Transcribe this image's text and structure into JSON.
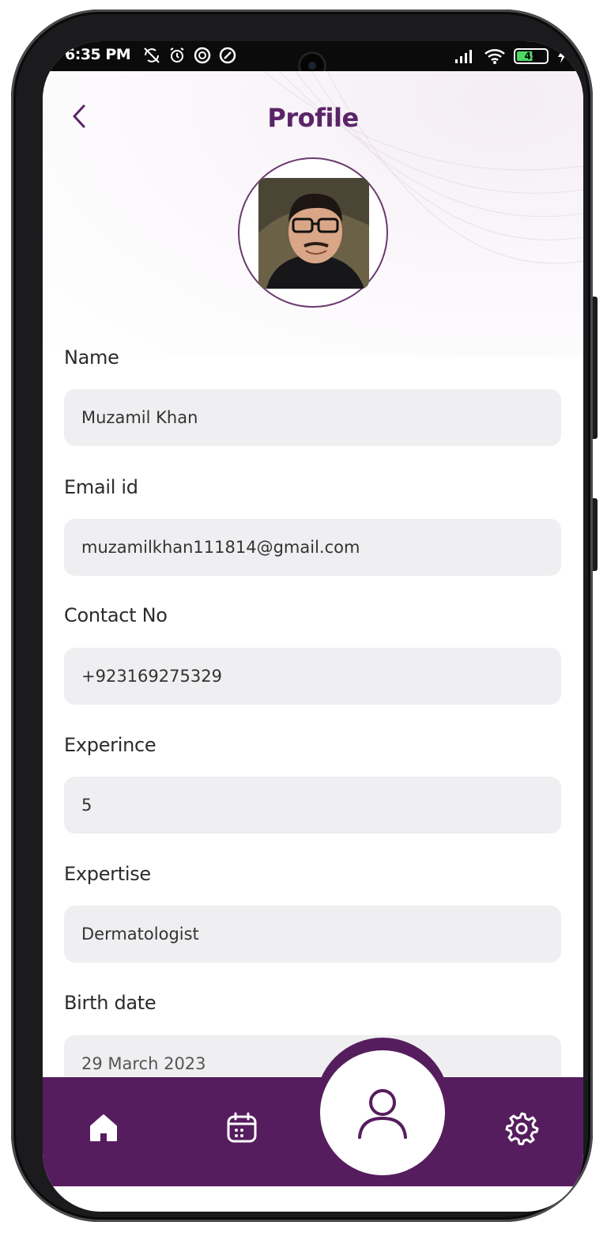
{
  "status_bar": {
    "time": "6:35 PM",
    "left_icons": [
      "sync-off-icon",
      "alarm-icon",
      "vpn-icon",
      "vpn-icon"
    ],
    "right_icons": [
      "signal-icon",
      "wifi-icon",
      "battery-icon",
      "charging-icon"
    ],
    "battery_level": "45"
  },
  "header": {
    "back_icon": "chevron-left-icon",
    "title": "Profile"
  },
  "profile": {
    "avatar": "profile-photo"
  },
  "fields": [
    {
      "label": "Name",
      "value": "Muzamil Khan"
    },
    {
      "label": "Email id",
      "value": "muzamilkhan111814@gmail.com"
    },
    {
      "label": "Contact No",
      "value": "+923169275329"
    },
    {
      "label": "Experince",
      "value": "5"
    },
    {
      "label": "Expertise",
      "value": "Dermatologist"
    },
    {
      "label": "Birth date",
      "value": "29 March 2023"
    }
  ],
  "bottom_nav": {
    "items": [
      {
        "icon": "home-icon",
        "active": false
      },
      {
        "icon": "calendar-icon",
        "active": false
      },
      {
        "icon": "user-icon",
        "active": true
      },
      {
        "icon": "gear-icon",
        "active": false
      }
    ]
  },
  "colors": {
    "brand": "#561d5e",
    "title": "#5a2467",
    "field_bg": "#efeef0"
  }
}
